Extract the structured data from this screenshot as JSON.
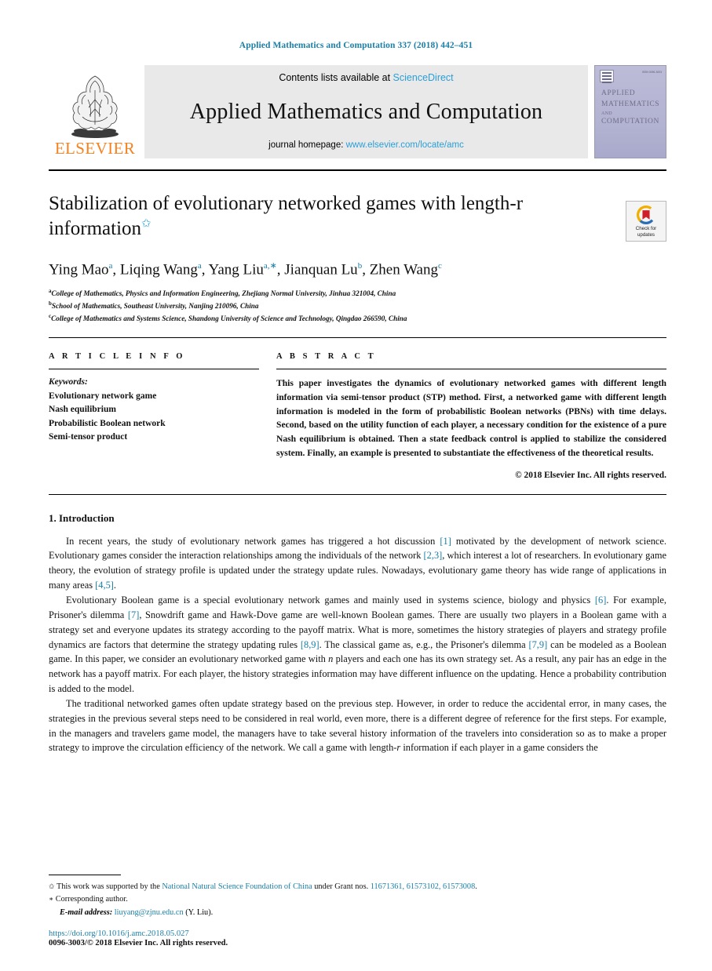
{
  "running_head": "Applied Mathematics and Computation 337 (2018) 442–451",
  "masthead": {
    "publisher_name": "ELSEVIER",
    "contents_prefix": "Contents lists available at ",
    "contents_link": "ScienceDirect",
    "journal_title": "Applied Mathematics and Computation",
    "homepage_prefix": "journal homepage: ",
    "homepage_link": "www.elsevier.com/locate/amc",
    "cover": {
      "line1": "APPLIED",
      "line2": "MATHEMATICS",
      "line3": "AND",
      "line4": "COMPUTATION",
      "issn_corner": "ISSN 0096-3003"
    }
  },
  "article": {
    "title": "Stabilization of evolutionary networked games with length-r information",
    "title_star": "✩",
    "crossmark": {
      "line1": "Check for",
      "line2": "updates"
    },
    "authors_html": "Ying Mao<sup>a</sup>, Liqing Wang<sup>a</sup>, Yang Liu<sup>a,</sup><sup>∗</sup>, Jianquan Lu<sup>b</sup>, Zhen Wang<sup>c</sup>",
    "affiliations": [
      {
        "mark": "a",
        "text": "College of Mathematics, Physics and Information Engineering, Zhejiang Normal University, Jinhua 321004, China"
      },
      {
        "mark": "b",
        "text": "School of Mathematics, Southeast University, Nanjing 210096, China"
      },
      {
        "mark": "c",
        "text": "College of Mathematics and Systems Science, Shandong University of Science and Technology, Qingdao 266590, China"
      }
    ]
  },
  "article_info": {
    "heading": "A R T I C L E    I N F O",
    "keywords_label": "Keywords:",
    "keywords": [
      "Evolutionary network game",
      "Nash equilibrium",
      "Probabilistic Boolean network",
      "Semi-tensor product"
    ]
  },
  "abstract": {
    "heading": "A B S T R A C T",
    "text": "This paper investigates the dynamics of evolutionary networked games with different length information via semi-tensor product (STP) method. First, a networked game with different length information is modeled in the form of probabilistic Boolean networks (PBNs) with time delays. Second, based on the utility function of each player, a necessary condition for the existence of a pure Nash equilibrium is obtained. Then a state feedback control is applied to stabilize the considered system. Finally, an example is presented to substantiate the effectiveness of the theoretical results.",
    "copyright": "© 2018 Elsevier Inc. All rights reserved."
  },
  "body": {
    "section_number_title": "1. Introduction",
    "paragraphs": [
      "In recent years, the study of evolutionary network games has triggered a hot discussion [1] motivated by the development of network science. Evolutionary games consider the interaction relationships among the individuals of the network [2,3], which interest a lot of researchers. In evolutionary game theory, the evolution of strategy profile is updated under the strategy update rules. Nowadays, evolutionary game theory has wide range of applications in many areas [4,5].",
      "Evolutionary Boolean game is a special evolutionary network games and mainly used in systems science, biology and physics [6]. For example, Prisoner's dilemma [7], Snowdrift game and Hawk-Dove game are well-known Boolean games. There are usually two players in a Boolean game with a strategy set and everyone updates its strategy according to the payoff matrix. What is more, sometimes the history strategies of players and strategy profile dynamics are factors that determine the strategy updating rules [8,9]. The classical game as, e.g., the Prisoner's dilemma [7,9] can be modeled as a Boolean game. In this paper, we consider an evolutionary networked game with n players and each one has its own strategy set. As a result, any pair has an edge in the network has a payoff matrix. For each player, the history strategies information may have different influence on the updating. Hence a probability contribution is added to the model.",
      "The traditional networked games often update strategy based on the previous step. However, in order to reduce the accidental error, in many cases, the strategies in the previous several steps need to be considered in real world, even more, there is a different degree of reference for the first steps. For example, in the managers and travelers game model, the managers have to take several history information of the travelers into consideration so as to make a proper strategy to improve the circulation efficiency of the network. We call a game with length-r information if each player in a game considers the"
    ]
  },
  "footnotes": {
    "funding_mark": "✩",
    "funding_pre": "This work was supported by the ",
    "funding_org": "National Natural Science Foundation of China",
    "funding_mid": " under Grant nos. ",
    "grants": "11671361, 61573102, 61573008",
    "funding_end": ".",
    "corresponding_mark": "∗",
    "corresponding": "Corresponding author.",
    "email_label": "E-mail address:",
    "email": "liuyang@zjnu.edu.cn",
    "email_owner": "(Y. Liu).",
    "doi": "https://doi.org/10.1016/j.amc.2018.05.027",
    "issn_line": "0096-3003/© 2018 Elsevier Inc. All rights reserved."
  },
  "colors": {
    "link": "#1a7fa8",
    "sciencedirect": "#2a9fd6",
    "elsevier_orange": "#f58220",
    "band_gray": "#e9e9e9"
  }
}
